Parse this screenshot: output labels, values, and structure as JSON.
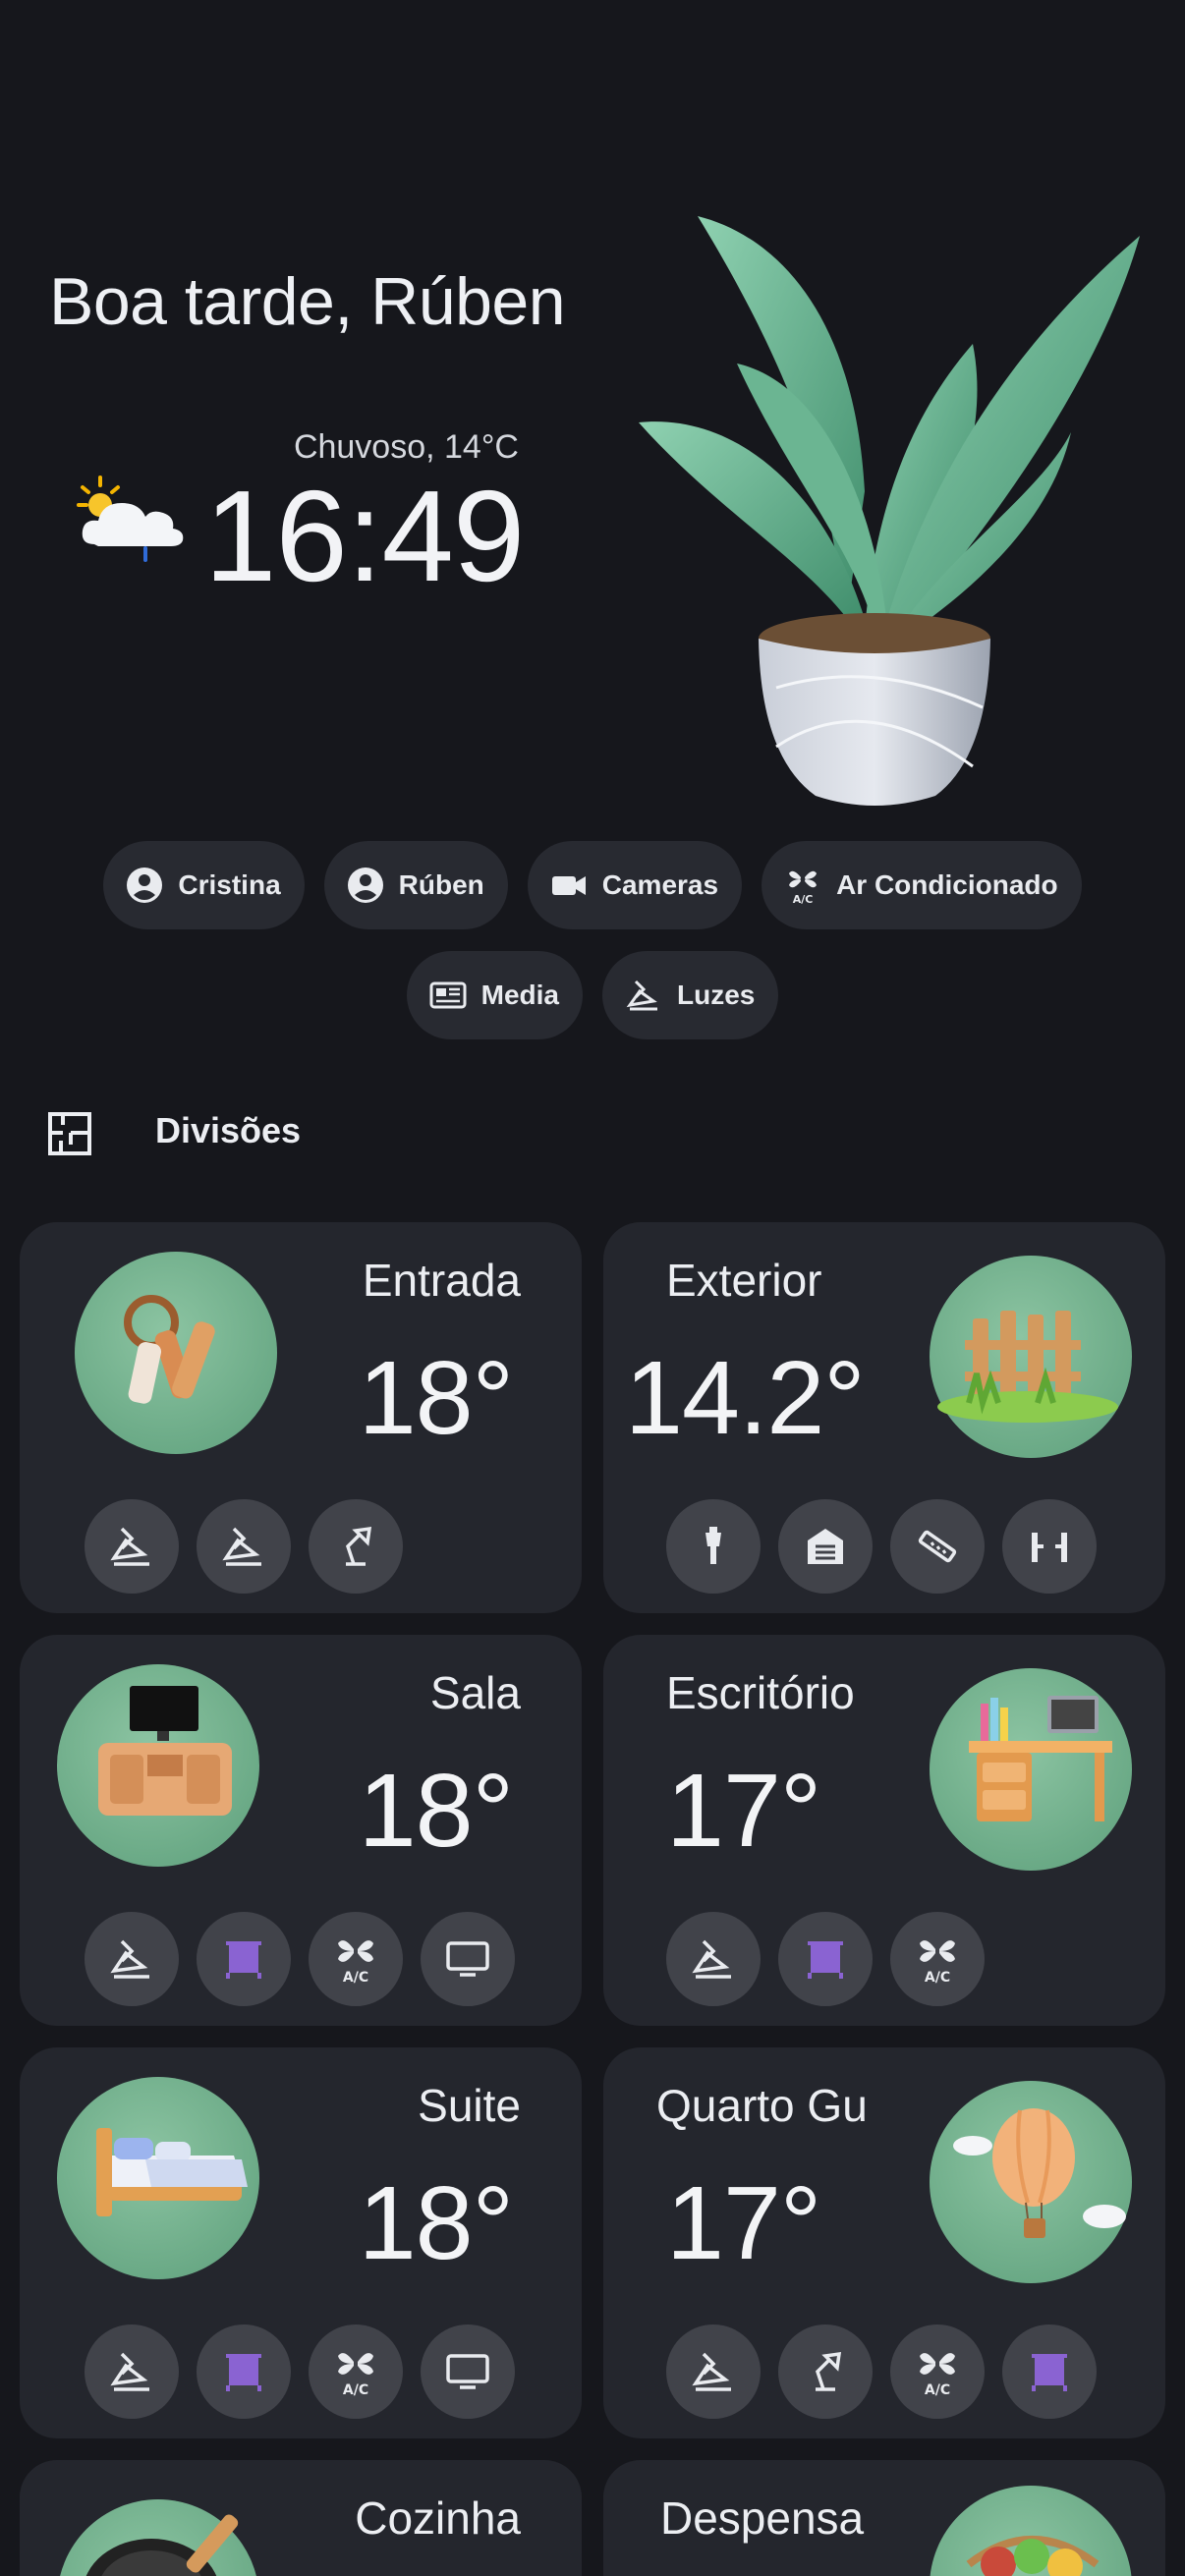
{
  "header": {
    "greeting": "Boa tarde, Rúben",
    "weather": "Chuvoso, 14°C",
    "time": "16:49",
    "weather_icon": "partly-sunny-rain-icon"
  },
  "chips": [
    {
      "label": "Cristina",
      "icon": "person-icon"
    },
    {
      "label": "Rúben",
      "icon": "person-icon"
    },
    {
      "label": "Cameras",
      "icon": "video-camera-icon"
    },
    {
      "label": "Ar Condicionado",
      "icon": "ac-fan-icon"
    },
    {
      "label": "Media",
      "icon": "media-news-icon"
    },
    {
      "label": "Luzes",
      "icon": "ceiling-lamp-icon"
    }
  ],
  "section": {
    "title": "Divisões",
    "icon": "floor-plan-icon"
  },
  "rooms": [
    {
      "name": "Entrada",
      "temp": "18°",
      "image": "keys",
      "devices": [
        "ceiling-lamp-icon",
        "ceiling-lamp-icon",
        "desk-lamp-icon"
      ]
    },
    {
      "name": "Exterior",
      "temp": "14.2°",
      "image": "fence",
      "devices": [
        "outdoor-lamp-icon",
        "garage-icon",
        "sprinkler-icon",
        "gate-icon"
      ]
    },
    {
      "name": "Sala",
      "temp": "18°",
      "image": "tv-unit",
      "devices": [
        "ceiling-lamp-icon",
        "blinds-icon",
        "ac-fan-icon",
        "tv-icon"
      ]
    },
    {
      "name": "Escritório",
      "temp": "17°",
      "image": "desk",
      "devices": [
        "ceiling-lamp-icon",
        "blinds-icon",
        "ac-fan-icon"
      ]
    },
    {
      "name": "Suite",
      "temp": "18°",
      "image": "bed",
      "devices": [
        "ceiling-lamp-icon",
        "blinds-icon",
        "ac-fan-icon",
        "tv-icon"
      ]
    },
    {
      "name": "Quarto Gu",
      "temp": "17°",
      "image": "balloon",
      "devices": [
        "ceiling-lamp-icon",
        "desk-lamp-icon",
        "ac-fan-icon",
        "blinds-icon"
      ]
    },
    {
      "name": "Cozinha",
      "temp": "",
      "image": "pan",
      "devices": []
    },
    {
      "name": "Despensa",
      "temp": "",
      "image": "basket",
      "devices": []
    }
  ],
  "colors": {
    "background": "#16171c",
    "card": "#24262d",
    "chip": "#282a31",
    "device": "#41434a",
    "avatar": "#6fae8a",
    "blinds": "#8a63d2"
  }
}
